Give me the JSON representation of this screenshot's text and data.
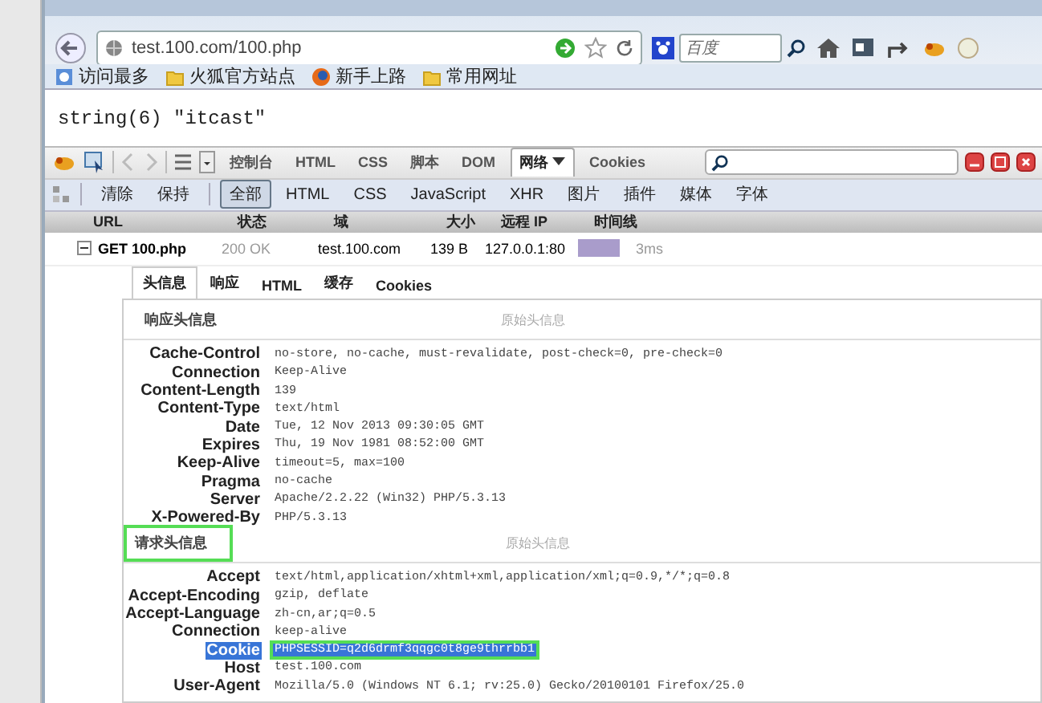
{
  "address_bar": {
    "url": "test.100.com/100.php"
  },
  "search_box": {
    "placeholder": "百度"
  },
  "bookmarks": [
    "访问最多",
    "火狐官方站点",
    "新手上路",
    "常用网址"
  ],
  "page_output": "string(6) \"itcast\"",
  "firebug": {
    "panels": [
      {
        "label": "控制台",
        "selected": false,
        "dropdown": false
      },
      {
        "label": "HTML",
        "selected": false,
        "dropdown": false
      },
      {
        "label": "CSS",
        "selected": false,
        "dropdown": false
      },
      {
        "label": "脚本",
        "selected": false,
        "dropdown": false
      },
      {
        "label": "DOM",
        "selected": false,
        "dropdown": false
      },
      {
        "label": "网络",
        "selected": true,
        "dropdown": true
      },
      {
        "label": "Cookies",
        "selected": false,
        "dropdown": false
      }
    ],
    "actions": [
      "清除",
      "保持"
    ],
    "filters": [
      {
        "label": "全部",
        "selected": true
      },
      {
        "label": "HTML",
        "selected": false
      },
      {
        "label": "CSS",
        "selected": false
      },
      {
        "label": "JavaScript",
        "selected": false
      },
      {
        "label": "XHR",
        "selected": false
      },
      {
        "label": "图片",
        "selected": false
      },
      {
        "label": "插件",
        "selected": false
      },
      {
        "label": "媒体",
        "selected": false
      },
      {
        "label": "字体",
        "selected": false
      }
    ]
  },
  "net_table": {
    "columns": [
      "URL",
      "状态",
      "域",
      "大小",
      "远程 IP",
      "时间线"
    ],
    "rows": [
      {
        "expanded": true,
        "url": "GET 100.php",
        "status": "200 OK",
        "domain": "test.100.com",
        "size": "139 B",
        "remote_ip": "127.0.0.1:80",
        "time": "3ms"
      }
    ]
  },
  "detail_tabs": [
    {
      "label": "头信息",
      "selected": true
    },
    {
      "label": "响应",
      "selected": false
    },
    {
      "label": "HTML",
      "selected": false
    },
    {
      "label": "缓存",
      "selected": false
    },
    {
      "label": "Cookies",
      "selected": false
    }
  ],
  "sections": [
    {
      "title": "响应头信息",
      "view_source": "原始头信息",
      "highlighted": false,
      "headers": [
        {
          "name": "Cache-Control",
          "value": "no-store, no-cache, must-revalidate, post-check=0, pre-check=0",
          "selected": false
        },
        {
          "name": "Connection",
          "value": "Keep-Alive",
          "selected": false
        },
        {
          "name": "Content-Length",
          "value": "139",
          "selected": false
        },
        {
          "name": "Content-Type",
          "value": "text/html",
          "selected": false
        },
        {
          "name": "Date",
          "value": "Tue, 12 Nov 2013 09:30:05 GMT",
          "selected": false
        },
        {
          "name": "Expires",
          "value": "Thu, 19 Nov 1981 08:52:00 GMT",
          "selected": false
        },
        {
          "name": "Keep-Alive",
          "value": "timeout=5, max=100",
          "selected": false
        },
        {
          "name": "Pragma",
          "value": "no-cache",
          "selected": false
        },
        {
          "name": "Server",
          "value": "Apache/2.2.22 (Win32) PHP/5.3.13",
          "selected": false
        },
        {
          "name": "X-Powered-By",
          "value": "PHP/5.3.13",
          "selected": false
        }
      ]
    },
    {
      "title": "请求头信息",
      "view_source": "原始头信息",
      "highlighted": true,
      "headers": [
        {
          "name": "Accept",
          "value": "text/html,application/xhtml+xml,application/xml;q=0.9,*/*;q=0.8",
          "selected": false
        },
        {
          "name": "Accept-Encoding",
          "value": "gzip, deflate",
          "selected": false
        },
        {
          "name": "Accept-Language",
          "value": "zh-cn,ar;q=0.5",
          "selected": false
        },
        {
          "name": "Connection",
          "value": "keep-alive",
          "selected": false
        },
        {
          "name": "Cookie",
          "value": "PHPSESSID=q2d6drmf3qqgc0t8ge9thrrbb1",
          "selected": true
        },
        {
          "name": "Host",
          "value": "test.100.com",
          "selected": false
        },
        {
          "name": "User-Agent",
          "value": "Mozilla/5.0 (Windows NT 6.1; rv:25.0) Gecko/20100101 Firefox/25.0",
          "selected": false
        }
      ]
    }
  ]
}
